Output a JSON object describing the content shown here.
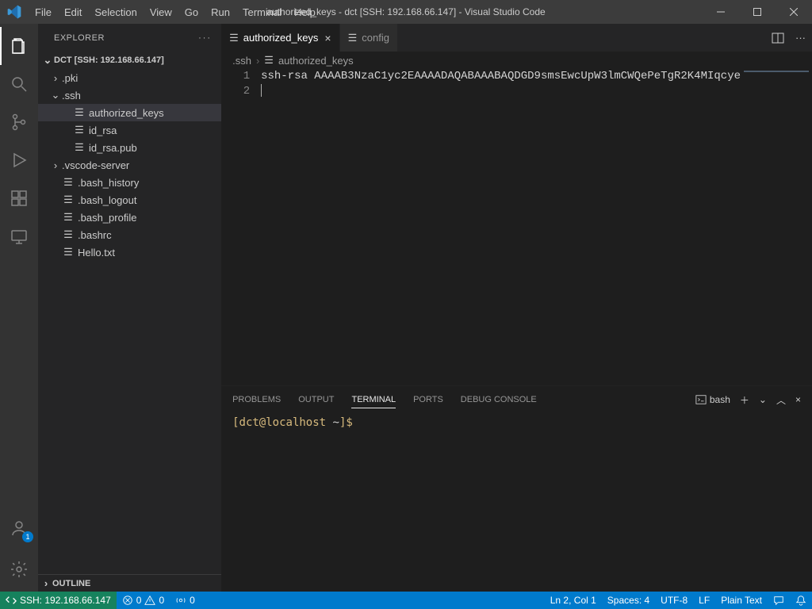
{
  "title": "authorized_keys - dct [SSH: 192.168.66.147] - Visual Studio Code",
  "menu": [
    "File",
    "Edit",
    "Selection",
    "View",
    "Go",
    "Run",
    "Terminal",
    "Help"
  ],
  "sidebar": {
    "title": "EXPLORER",
    "root": "DCT [SSH: 192.168.66.147]",
    "items": [
      {
        "label": ".pki",
        "type": "folder",
        "depth": 0,
        "open": false
      },
      {
        "label": ".ssh",
        "type": "folder",
        "depth": 0,
        "open": true
      },
      {
        "label": "authorized_keys",
        "type": "file",
        "depth": 1,
        "selected": true
      },
      {
        "label": "id_rsa",
        "type": "file",
        "depth": 1
      },
      {
        "label": "id_rsa.pub",
        "type": "file",
        "depth": 1
      },
      {
        "label": ".vscode-server",
        "type": "folder",
        "depth": 0,
        "open": false
      },
      {
        "label": ".bash_history",
        "type": "file",
        "depth": 0
      },
      {
        "label": ".bash_logout",
        "type": "file",
        "depth": 0
      },
      {
        "label": ".bash_profile",
        "type": "file",
        "depth": 0
      },
      {
        "label": ".bashrc",
        "type": "file",
        "depth": 0
      },
      {
        "label": "Hello.txt",
        "type": "file",
        "depth": 0
      }
    ],
    "outline": "OUTLINE"
  },
  "tabs": [
    {
      "label": "authorized_keys",
      "active": true,
      "close": true
    },
    {
      "label": "config",
      "active": false,
      "close": false
    }
  ],
  "breadcrumbs": [
    ".ssh",
    "authorized_keys"
  ],
  "editor": {
    "lines": [
      "1",
      "2"
    ],
    "content": "ssh-rsa AAAAB3NzaC1yc2EAAAADAQABAAABAQDGD9smsEwcUpW3lmCWQePeTgR2K4MIqcye"
  },
  "panel": {
    "tabs": [
      "PROBLEMS",
      "OUTPUT",
      "TERMINAL",
      "PORTS",
      "DEBUG CONSOLE"
    ],
    "active": "TERMINAL",
    "shell": "bash",
    "prompt": {
      "userhost": "[dct@localhost ",
      "dir": "~",
      "end": "]$"
    }
  },
  "status": {
    "remote": "SSH: 192.168.66.147",
    "errors": "0",
    "warnings": "0",
    "ports": "0",
    "lncol": "Ln 2, Col 1",
    "spaces": "Spaces: 4",
    "encoding": "UTF-8",
    "eol": "LF",
    "lang": "Plain Text"
  },
  "account_badge": "1"
}
